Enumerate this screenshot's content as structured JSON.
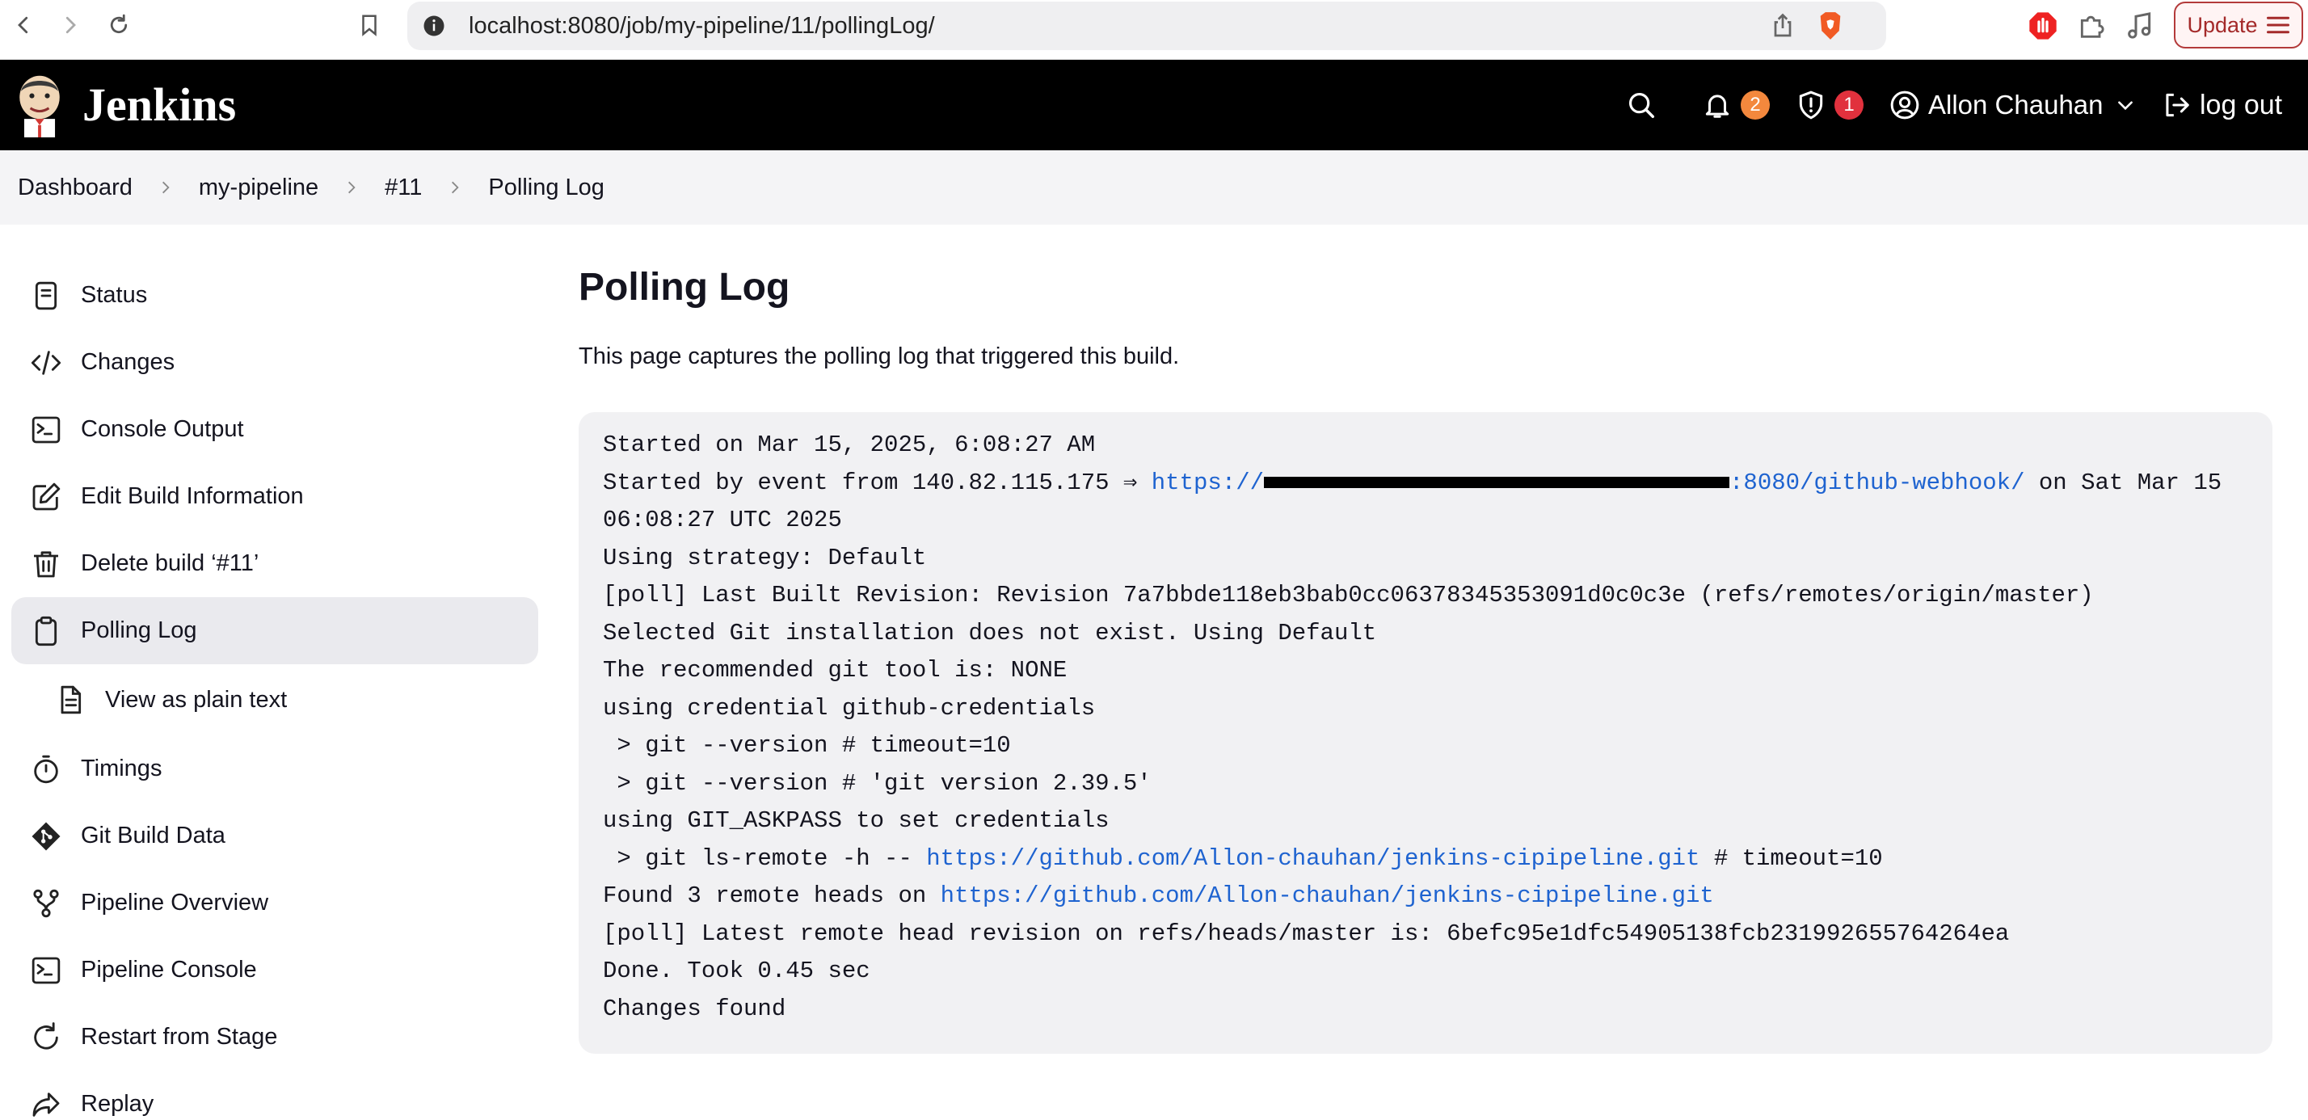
{
  "browser": {
    "url": "localhost:8080/job/my-pipeline/11/pollingLog/",
    "update_label": "Update"
  },
  "header": {
    "brand": "Jenkins",
    "notifications_count": "2",
    "security_count": "1",
    "user_name": "Allon Chauhan",
    "logout_label": "log out"
  },
  "breadcrumb": [
    "Dashboard",
    "my-pipeline",
    "#11",
    "Polling Log"
  ],
  "sidebar": {
    "items": [
      {
        "label": "Status",
        "icon": "document-icon"
      },
      {
        "label": "Changes",
        "icon": "code-icon"
      },
      {
        "label": "Console Output",
        "icon": "terminal-icon"
      },
      {
        "label": "Edit Build Information",
        "icon": "edit-icon"
      },
      {
        "label": "Delete build ‘#11’",
        "icon": "trash-icon"
      },
      {
        "label": "Polling Log",
        "icon": "clipboard-icon",
        "active": true
      },
      {
        "label": "View as plain text",
        "icon": "file-text-icon",
        "sub": true
      },
      {
        "label": "Timings",
        "icon": "stopwatch-icon"
      },
      {
        "label": "Git Build Data",
        "icon": "git-icon"
      },
      {
        "label": "Pipeline Overview",
        "icon": "branch-icon"
      },
      {
        "label": "Pipeline Console",
        "icon": "terminal-icon"
      },
      {
        "label": "Restart from Stage",
        "icon": "restart-icon"
      },
      {
        "label": "Replay",
        "icon": "replay-icon"
      }
    ]
  },
  "main": {
    "title": "Polling Log",
    "description": "This page captures the polling log that triggered this build.",
    "log": {
      "line1": "Started on Mar 15, 2025, 6:08:27 AM",
      "line2_prefix": "Started by event from 140.82.115.175 ⇒ ",
      "line2_link_start": "https://",
      "line2_link_end": ":8080/github-webhook/",
      "line2_suffix": " on Sat Mar 15",
      "line3": "06:08:27 UTC 2025",
      "line4": "Using strategy: Default",
      "line5": "[poll] Last Built Revision: Revision 7a7bbde118eb3bab0cc06378345353091d0c0c3e (refs/remotes/origin/master)",
      "line6": "Selected Git installation does not exist. Using Default",
      "line7": "The recommended git tool is: NONE",
      "line8": "using credential github-credentials",
      "line9": " > git --version # timeout=10",
      "line10": " > git --version # 'git version 2.39.5'",
      "line11": "using GIT_ASKPASS to set credentials",
      "line12_prefix": " > git ls-remote -h -- ",
      "line12_link": "https://github.com/Allon-chauhan/jenkins-cipipeline.git",
      "line12_suffix": " # timeout=10",
      "line13_prefix": "Found 3 remote heads on ",
      "line13_link": "https://github.com/Allon-chauhan/jenkins-cipipeline.git",
      "line14": "[poll] Latest remote head revision on refs/heads/master is: 6befc95e1dfc54905138fcb231992655764264ea",
      "line15": "Done. Took 0.45 sec",
      "line16": "Changes found"
    }
  }
}
